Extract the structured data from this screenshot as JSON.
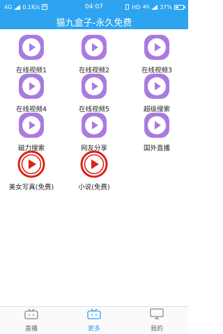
{
  "status_bar": {
    "network": "4G",
    "speed": "0.1K/s",
    "time": "04:07",
    "hd": "HD",
    "network2": "4G",
    "battery": "37%",
    "battery_level": 0.37
  },
  "header": {
    "title": "猫九盒子-永久免费"
  },
  "grid": {
    "items": [
      {
        "label": "在线视频1",
        "icon": "play-rounded-square-icon"
      },
      {
        "label": "在线视频2",
        "icon": "play-rounded-square-icon"
      },
      {
        "label": "在线视频3",
        "icon": "play-rounded-square-icon"
      },
      {
        "label": "在线视频4",
        "icon": "play-rounded-square-icon"
      },
      {
        "label": "在线视频5",
        "icon": "play-rounded-square-icon"
      },
      {
        "label": "超级搜索",
        "icon": "play-rounded-square-icon"
      },
      {
        "label": "磁力搜索",
        "icon": "play-rounded-square-icon"
      },
      {
        "label": "网友分享",
        "icon": "play-rounded-square-icon"
      },
      {
        "label": "国外直播",
        "icon": "play-rounded-square-icon"
      },
      {
        "label": "美女写真(免费)",
        "icon": "play-circle-red-icon"
      },
      {
        "label": "小说(免费)",
        "icon": "play-circle-red-icon"
      }
    ]
  },
  "tab_bar": {
    "tabs": [
      {
        "label": "直播",
        "icon": "tv-icon",
        "active": false
      },
      {
        "label": "更多",
        "icon": "tv-icon",
        "active": true
      },
      {
        "label": "我的",
        "icon": "monitor-icon",
        "active": false
      }
    ]
  },
  "colors": {
    "accent": "#2ea4f0",
    "purple_icon": "#a97be0",
    "red_icon": "#d9231a"
  }
}
